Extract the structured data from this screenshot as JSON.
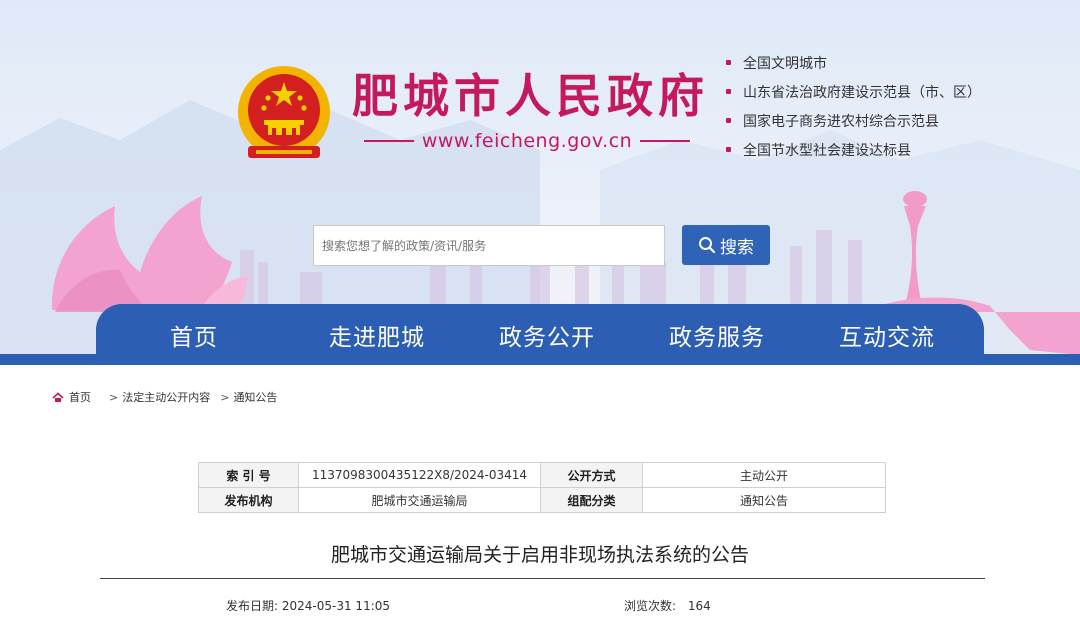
{
  "header": {
    "site_title": "肥城市人民政府",
    "site_url": "www.feicheng.gov.cn",
    "honors": [
      "全国文明城市",
      "山东省法治政府建设示范县（市、区）",
      "国家电子商务进农村综合示范县",
      "全国节水型社会建设达标县"
    ]
  },
  "search": {
    "placeholder": "搜索您想了解的政策/资讯/服务",
    "button_label": "搜索"
  },
  "nav": {
    "items": [
      "首页",
      "走进肥城",
      "政务公开",
      "政务服务",
      "互动交流"
    ]
  },
  "breadcrumb": {
    "home": "首页",
    "level1": "法定主动公开内容",
    "level2": "通知公告",
    "separator": ">"
  },
  "meta": {
    "index_label": "索 引 号",
    "index_value": "1137098300435122X8/2024-03414",
    "disclosure_label": "公开方式",
    "disclosure_value": "主动公开",
    "publisher_label": "发布机构",
    "publisher_value": "肥城市交通运输局",
    "category_label": "组配分类",
    "category_value": "通知公告"
  },
  "article": {
    "title": "肥城市交通运输局关于启用非现场执法系统的公告",
    "date_label": "发布日期:",
    "date_value": "2024-05-31 11:05",
    "views_label": "浏览次数:",
    "views_value": "164"
  },
  "colors": {
    "brand_red": "#c4195c",
    "nav_blue": "#2c5fb4",
    "button_blue": "#2f63b8"
  },
  "icons": {
    "emblem": "national-emblem-icon",
    "search": "magnifier-icon",
    "home": "home-icon"
  }
}
